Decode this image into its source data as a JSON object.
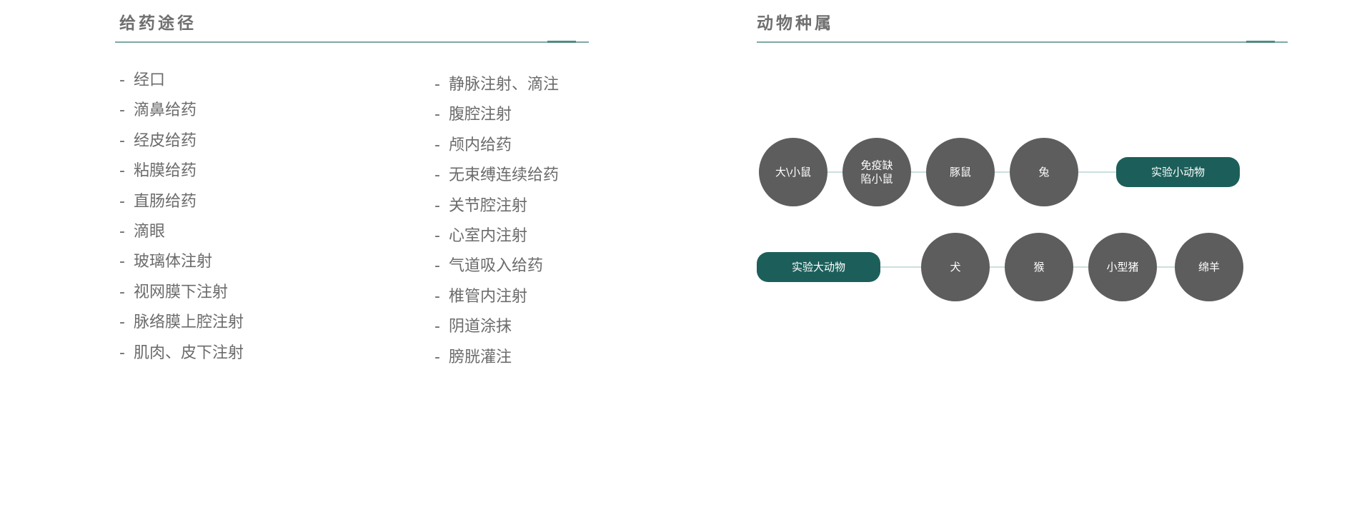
{
  "routes": {
    "title": "给药途径",
    "bullet": "-",
    "column1": [
      "经口",
      "滴鼻给药",
      "经皮给药",
      "粘膜给药",
      "直肠给药",
      "滴眼",
      "玻璃体注射",
      "视网膜下注射",
      "脉络膜上腔注射",
      "肌肉、皮下注射"
    ],
    "column2": [
      "静脉注射、滴注",
      "腹腔注射",
      "颅内给药",
      "无束缚连续给药",
      "关节腔注射",
      "心室内注射",
      "气道吸入给药",
      "椎管内注射",
      "阴道涂抹",
      "膀胱灌注"
    ]
  },
  "species": {
    "title": "动物种属",
    "small": {
      "label": "实验小动物",
      "items": [
        [
          "大\\小鼠"
        ],
        [
          "免疫缺",
          "陷小鼠"
        ],
        [
          "豚鼠"
        ],
        [
          "兔"
        ]
      ]
    },
    "large": {
      "label": "实验大动物",
      "items": [
        [
          "犬"
        ],
        [
          "猴"
        ],
        [
          "小型猪"
        ],
        [
          "绵羊"
        ]
      ]
    }
  },
  "colors": {
    "accent": "#1c5f5a",
    "circle": "#5e5d5d",
    "rule": "#7fa9a5",
    "connector": "#b9d6d3"
  }
}
